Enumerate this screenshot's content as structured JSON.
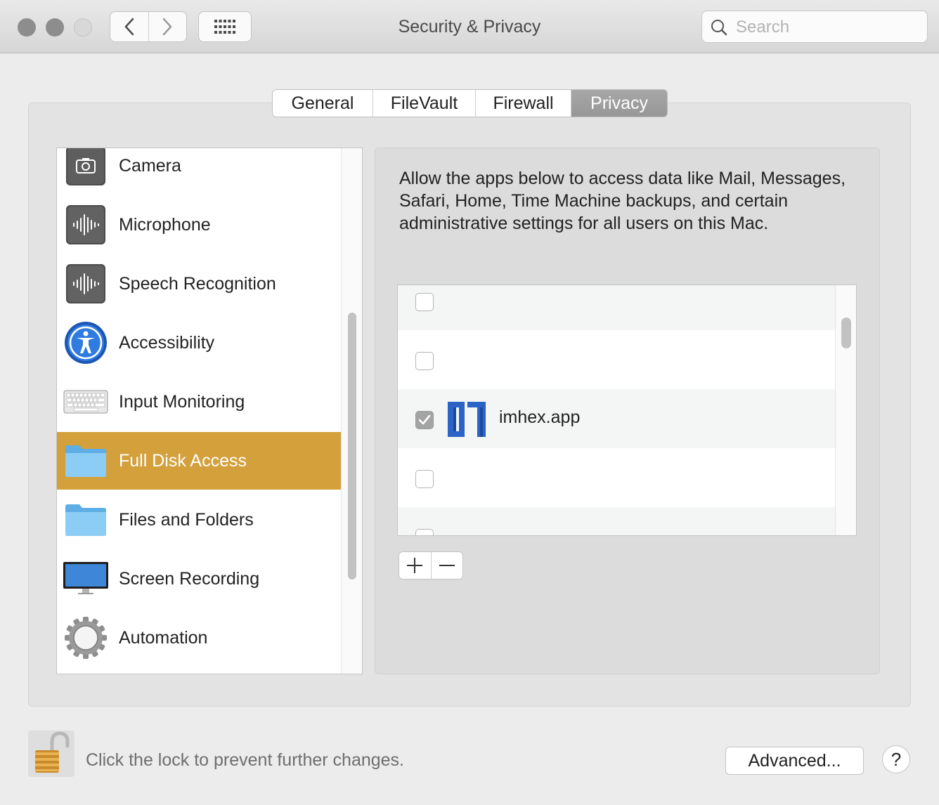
{
  "window": {
    "title": "Security & Privacy",
    "search_placeholder": "Search"
  },
  "tabs": [
    {
      "label": "General",
      "active": false
    },
    {
      "label": "FileVault",
      "active": false
    },
    {
      "label": "Firewall",
      "active": false
    },
    {
      "label": "Privacy",
      "active": true
    }
  ],
  "sidebar": {
    "selected_index": 5,
    "items": [
      {
        "label": "Camera",
        "icon": "camera-icon"
      },
      {
        "label": "Microphone",
        "icon": "microphone-icon"
      },
      {
        "label": "Speech Recognition",
        "icon": "speech-recognition-icon"
      },
      {
        "label": "Accessibility",
        "icon": "accessibility-icon"
      },
      {
        "label": "Input Monitoring",
        "icon": "keyboard-icon"
      },
      {
        "label": "Full Disk Access",
        "icon": "folder-icon"
      },
      {
        "label": "Files and Folders",
        "icon": "folder-icon"
      },
      {
        "label": "Screen Recording",
        "icon": "display-icon"
      },
      {
        "label": "Automation",
        "icon": "gear-icon"
      }
    ]
  },
  "panel": {
    "description": "Allow the apps below to access data like Mail, Messages, Safari, Home, Time Machine backups, and certain administrative settings for all users on this Mac.",
    "apps": [
      {
        "name": "",
        "checked": false
      },
      {
        "name": "",
        "checked": false
      },
      {
        "name": "imhex.app",
        "checked": true,
        "icon": "imhex-app-icon"
      },
      {
        "name": "",
        "checked": false
      },
      {
        "name": "",
        "checked": false
      }
    ],
    "add_symbol": "+",
    "remove_symbol": "—"
  },
  "footer": {
    "lock_text": "Click the lock to prevent further changes.",
    "advanced_label": "Advanced...",
    "help_label": "?"
  },
  "colors": {
    "selection": "#d3a03b",
    "folder_blue": "#7cc3ef",
    "accessibility_blue": "#1f6fd6",
    "imhex_blue": "#2b63c6"
  }
}
